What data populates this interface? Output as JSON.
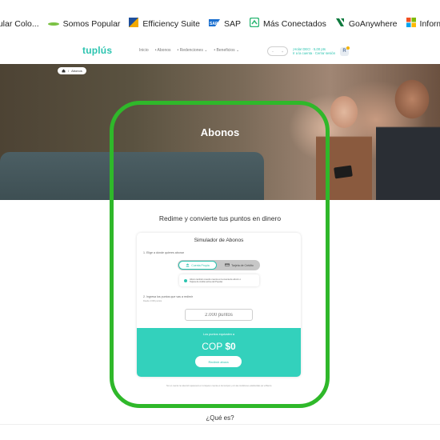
{
  "bookmarks": [
    {
      "label": "pular Colo...",
      "icon": "bookmark-icon",
      "color": "#555555"
    },
    {
      "label": "Somos Popular",
      "icon": "leaf-icon",
      "color": "#7ac143"
    },
    {
      "label": "Efficiency Suite",
      "icon": "suite-icon",
      "color": "#1e4f9c"
    },
    {
      "label": "SAP",
      "icon": "sap-icon",
      "color": "#1a6fcf"
    },
    {
      "label": "Más Conectados",
      "icon": "teams-icon",
      "color": "#2bb673"
    },
    {
      "label": "GoAnywhere",
      "icon": "goanywhere-icon",
      "color": "#0f7a3e"
    },
    {
      "label": "Informe_Se",
      "icon": "microsoft-icon",
      "color": "#f25022"
    }
  ],
  "header": {
    "logo": "tuplús",
    "nav": [
      "Inicio",
      "• Abonos",
      "• Redenciones ⌄",
      "• Beneficios ⌄"
    ],
    "account_line1": "¡Hola! DEC! · 5,00 pts",
    "account_line2": "Ir a la cuenta · Cerrar sesión",
    "brand_color": "#2cc4b0"
  },
  "hero": {
    "breadcrumb": "Abonos",
    "title": "Abonos"
  },
  "main": {
    "title": "Redime y convierte tus puntos en dinero"
  },
  "simulator": {
    "title": "Simulador de Abonos",
    "step1_label": "1. Elige a dónde quieres abonar",
    "option_account": "Cuenta Propia",
    "option_card": "Tarjeta de Crédito",
    "info_line1": "Abono también cuando cuenta en la cuenta de ahorro o",
    "info_line2": "Tarjeta de crédito activa del Popular.",
    "step2_label": "2. Ingresa los puntos que vas a redimir",
    "step2_hint": "Desde 2.000 puntos",
    "points_placeholder": "2.000 puntos",
    "result_label": "Los puntos equivalen a",
    "result_currency": "COP ",
    "result_amount": "$0",
    "redeem_button": "Redimir ahora",
    "result_color": "#33d1bc"
  },
  "disclaimer": "Ten en cuenta: la redención aparecerá en tu tarjeta o cuenta en los tiempos y con las condiciones establecidas por el Banco.",
  "section_next": "¿Qué es?",
  "highlight_color": "#2fb82a"
}
